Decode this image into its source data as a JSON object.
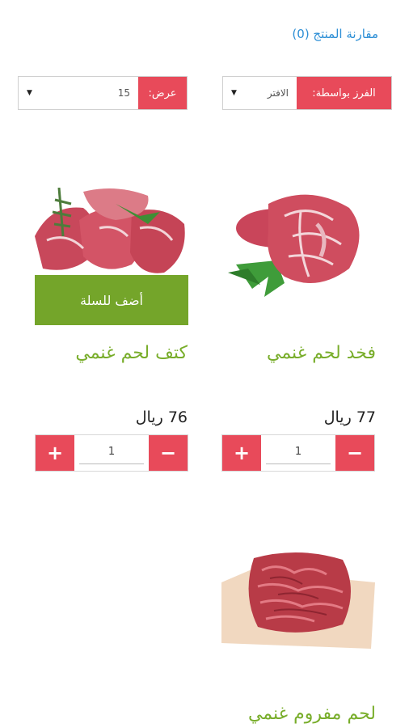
{
  "compare": {
    "label": "مقارنة المنتج (0)"
  },
  "sort": {
    "label": "الفرز بواسطة:",
    "value": "الافتر"
  },
  "show": {
    "label": "عرض:",
    "value": "15"
  },
  "add_to_cart_label": "أضف للسلة",
  "products": [
    {
      "name": "فخد لحم غنمي",
      "price": "77 ريال",
      "qty": "1",
      "image_icon": "lamb-leg-meat-image"
    },
    {
      "name": "كتف لحم غنمي",
      "price": "76 ريال",
      "qty": "1",
      "image_icon": "lamb-shoulder-meat-image"
    },
    {
      "name": "لحم مفروم غنمي",
      "image_icon": "minced-lamb-meat-image"
    }
  ],
  "qty_controls": {
    "minus": "−",
    "plus": "+"
  },
  "colors": {
    "accent_red": "#e84a5a",
    "accent_green": "#74a52a",
    "title_green": "#78ad2a",
    "link_blue": "#2d8fd6"
  }
}
